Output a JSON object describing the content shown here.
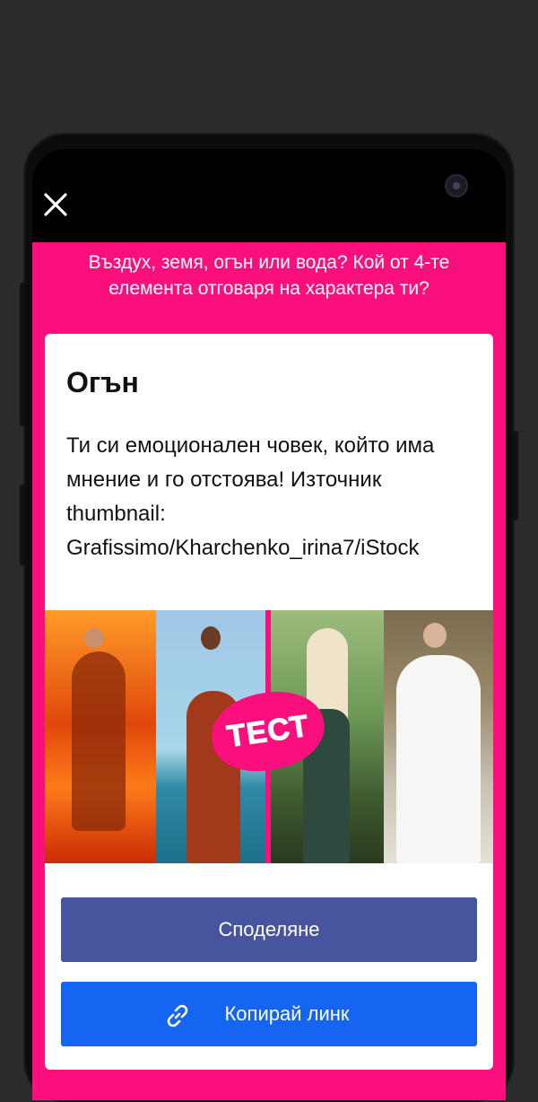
{
  "quiz": {
    "title": "Въздух, земя, огън или вода? Кой от 4-те елемента отговаря на характера ти?"
  },
  "result": {
    "title": "Огън",
    "description": "Ти си емоционален човек, който има мнение и го отстоява! Източник thumbnail: Grafissimo/Kharchenko_irina7/iStock"
  },
  "thumbnail": {
    "badge_text": "ТЕСТ"
  },
  "buttons": {
    "share_label": "Споделяне",
    "copy_link_label": "Копирай линк"
  },
  "icons": {
    "close": "close-icon",
    "link": "link-icon",
    "camera": "camera-icon"
  },
  "colors": {
    "accent_pink": "#fb0f7d",
    "share_button": "#47549e",
    "copy_button": "#1565f2"
  }
}
